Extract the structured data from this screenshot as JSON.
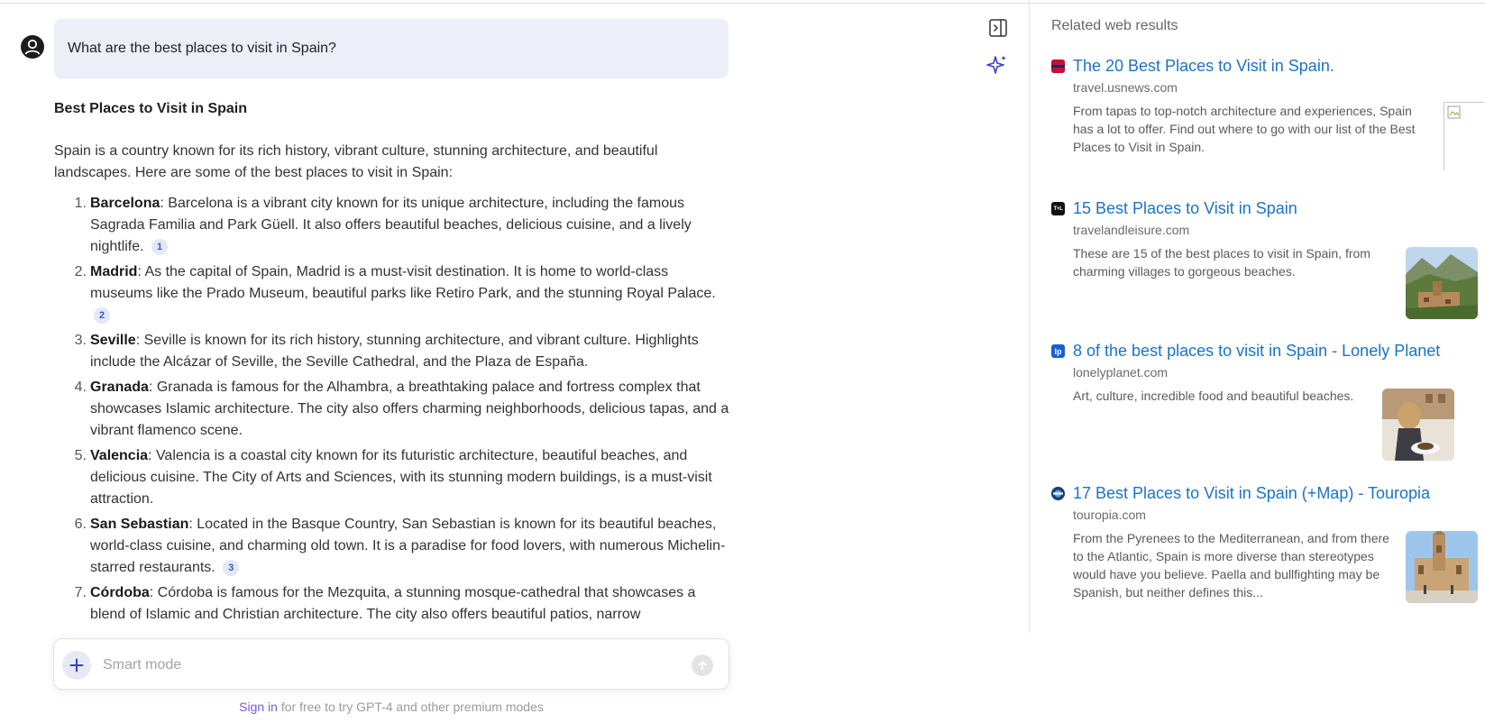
{
  "chat": {
    "question": "What are the best places to visit in Spain?",
    "answer_title": "Best Places to Visit in Spain",
    "intro": "Spain is a country known for its rich history, vibrant culture, stunning architecture, and beautiful landscapes. Here are some of the best places to visit in Spain:",
    "items": [
      {
        "num": "1.",
        "name": "Barcelona",
        "text": ": Barcelona is a vibrant city known for its unique architecture, including the famous Sagrada Familia and Park Güell. It also offers beautiful beaches, delicious cuisine, and a lively nightlife.",
        "cite": "1"
      },
      {
        "num": "2.",
        "name": "Madrid",
        "text": ": As the capital of Spain, Madrid is a must-visit destination. It is home to world-class museums like the Prado Museum, beautiful parks like Retiro Park, and the stunning Royal Palace.",
        "cite": "2"
      },
      {
        "num": "3.",
        "name": "Seville",
        "text": ": Seville is known for its rich history, stunning architecture, and vibrant culture. Highlights include the Alcázar of Seville, the Seville Cathedral, and the Plaza de España.",
        "cite": ""
      },
      {
        "num": "4.",
        "name": "Granada",
        "text": ": Granada is famous for the Alhambra, a breathtaking palace and fortress complex that showcases Islamic architecture. The city also offers charming neighborhoods, delicious tapas, and a vibrant flamenco scene.",
        "cite": ""
      },
      {
        "num": "5.",
        "name": "Valencia",
        "text": ": Valencia is a coastal city known for its futuristic architecture, beautiful beaches, and delicious cuisine. The City of Arts and Sciences, with its stunning modern buildings, is a must-visit attraction.",
        "cite": ""
      },
      {
        "num": "6.",
        "name": "San Sebastian",
        "text": ": Located in the Basque Country, San Sebastian is known for its beautiful beaches, world-class cuisine, and charming old town. It is a paradise for food lovers, with numerous Michelin-starred restaurants.",
        "cite": "3"
      },
      {
        "num": "7.",
        "name": "Córdoba",
        "text": ": Córdoba is famous for the Mezquita, a stunning mosque-cathedral that showcases a blend of Islamic and Christian architecture. The city also offers beautiful patios, narrow",
        "cite": ""
      }
    ],
    "input_placeholder": "Smart mode",
    "signin_link": "Sign in",
    "signin_text": " for free to try GPT-4 and other premium modes"
  },
  "related": {
    "heading": "Related web results",
    "results": [
      {
        "title": "The 20 Best Places to Visit in Spain.",
        "domain": "travel.usnews.com",
        "description": "From tapas to top-notch architecture and experiences, Spain has a lot to offer. Find out where to go with our list of the Best Places to Visit in Spain.",
        "favicon_color": "#c8102e",
        "image": "broken-image"
      },
      {
        "title": "15 Best Places to Visit in Spain",
        "domain": "travelandleisure.com",
        "description": "These are 15 of the best places to visit in Spain, from charming villages to gorgeous beaches.",
        "favicon_color": "#111111",
        "favicon_text": "T+L",
        "image": "mountain-village-photo"
      },
      {
        "title": "8 of the best places to visit in Spain - Lonely Planet",
        "domain": "lonelyplanet.com",
        "description": "Art, culture, incredible food and beautiful beaches.",
        "favicon_color": "#1a5fd1",
        "favicon_text": "lp",
        "image": "cafe-plaza-photo"
      },
      {
        "title": "17 Best Places to Visit in Spain (+Map) - Touropia",
        "domain": "touropia.com",
        "description": "From the Pyrenees to the Mediterranean, and from there to the Atlantic, Spain is more diverse than stereotypes would have you believe. Paella and bullfighting may be Spanish, but neither defines this...",
        "favicon_color": "#1c3f6e",
        "image": "cathedral-photo"
      }
    ]
  },
  "colors": {
    "accent": "#3b3fd1",
    "link": "#1a73c6",
    "question_bg": "#eceef8",
    "signin": "#7b5cd6"
  }
}
